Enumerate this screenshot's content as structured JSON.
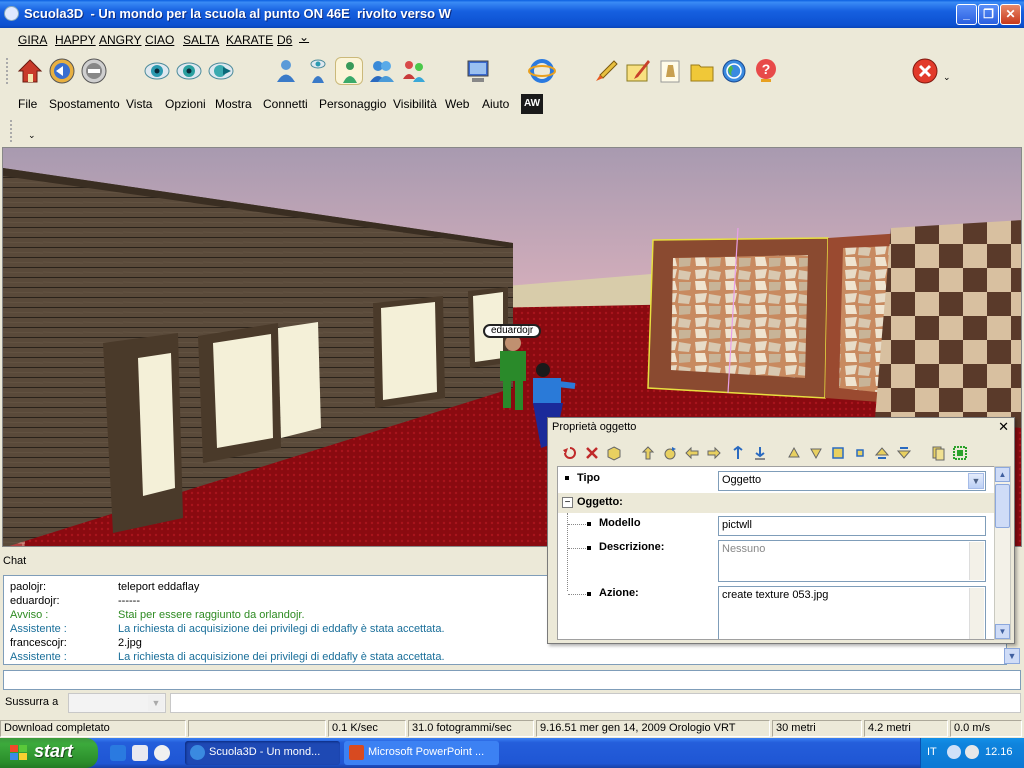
{
  "window": {
    "title": "Scuola3D  - Un mondo per la scuola al punto ON 46E  rivolto verso W",
    "buttons": {
      "minimize": "_",
      "maximize": "❐",
      "close": "✕"
    }
  },
  "gestures": [
    "GIRA",
    "HAPPY",
    "ANGRY",
    "CIAO",
    "SALTA",
    "KARATE",
    "D6"
  ],
  "gestures_more": "⌄",
  "menu": [
    "File",
    "Spostamento",
    "Vista",
    "Opzioni",
    "Mostra",
    "Connetti",
    "Personaggio",
    "Visibilità",
    "Web",
    "Aiuto"
  ],
  "aw_logo": "AW",
  "toolbar_icons": [
    "home-icon",
    "back-icon",
    "forward-icon",
    "eye-first-icon",
    "eye-second-icon",
    "eye-third-icon",
    "avatar-icon",
    "person-eye-icon",
    "person-selected-icon",
    "contacts-icon",
    "group-icon",
    "computer-icon",
    "browser-icon",
    "rocket-icon",
    "pen-icon",
    "note-icon",
    "folder-icon",
    "globe-icon",
    "help-icon",
    "stop-icon"
  ],
  "viewport": {
    "avatar_name": "eduardojr"
  },
  "chat": {
    "label": "Chat",
    "rows": [
      {
        "who": "paolojr:",
        "msg": "teleport eddaflay",
        "type": "user"
      },
      {
        "who": "eduardojr:",
        "msg": "------",
        "type": "user"
      },
      {
        "who": "Avviso :",
        "msg": "Stai per essere raggiunto da orlandojr.",
        "type": "warning"
      },
      {
        "who": "Assistente :",
        "msg": "La richiesta di acquisizione dei privilegi di eddafly è stata accettata.",
        "type": "assistant"
      },
      {
        "who": "francescojr:",
        "msg": "2.jpg",
        "type": "user"
      },
      {
        "who": "Assistente :",
        "msg": "La richiesta di acquisizione dei privilegi di eddafly è stata accettata.",
        "type": "assistant"
      }
    ],
    "colors": {
      "user": "#000000",
      "warning": "#2e8b22",
      "assistant": "#1a6f9a"
    }
  },
  "whisper": {
    "label": "Sussurra a"
  },
  "status": {
    "download": "Download completato",
    "speed": "0.1 K/sec",
    "fps": "31.0 fotogrammi/sec",
    "clock": "9.16.51 mer gen 14, 2009 Orologio VRT",
    "distance": "30 metri",
    "altitude": "4.2 metri",
    "velocity": "0.0 m/s"
  },
  "properties": {
    "title": "Proprietà oggetto",
    "close": "✕",
    "tipo_label": "Tipo",
    "tipo_value": "Oggetto",
    "group_label": "Oggetto:",
    "modello_label": "Modello",
    "modello_value": "pictwll",
    "descrizione_label": "Descrizione:",
    "descrizione_value": "Nessuno",
    "azione_label": "Azione:",
    "azione_value": "create texture 053.jpg"
  },
  "taskbar": {
    "start": "start",
    "tasks": [
      {
        "label": "Scuola3D  - Un mond...",
        "active": true
      },
      {
        "label": "Microsoft PowerPoint ...",
        "active": false
      }
    ],
    "lang": "IT",
    "time": "12.16"
  }
}
